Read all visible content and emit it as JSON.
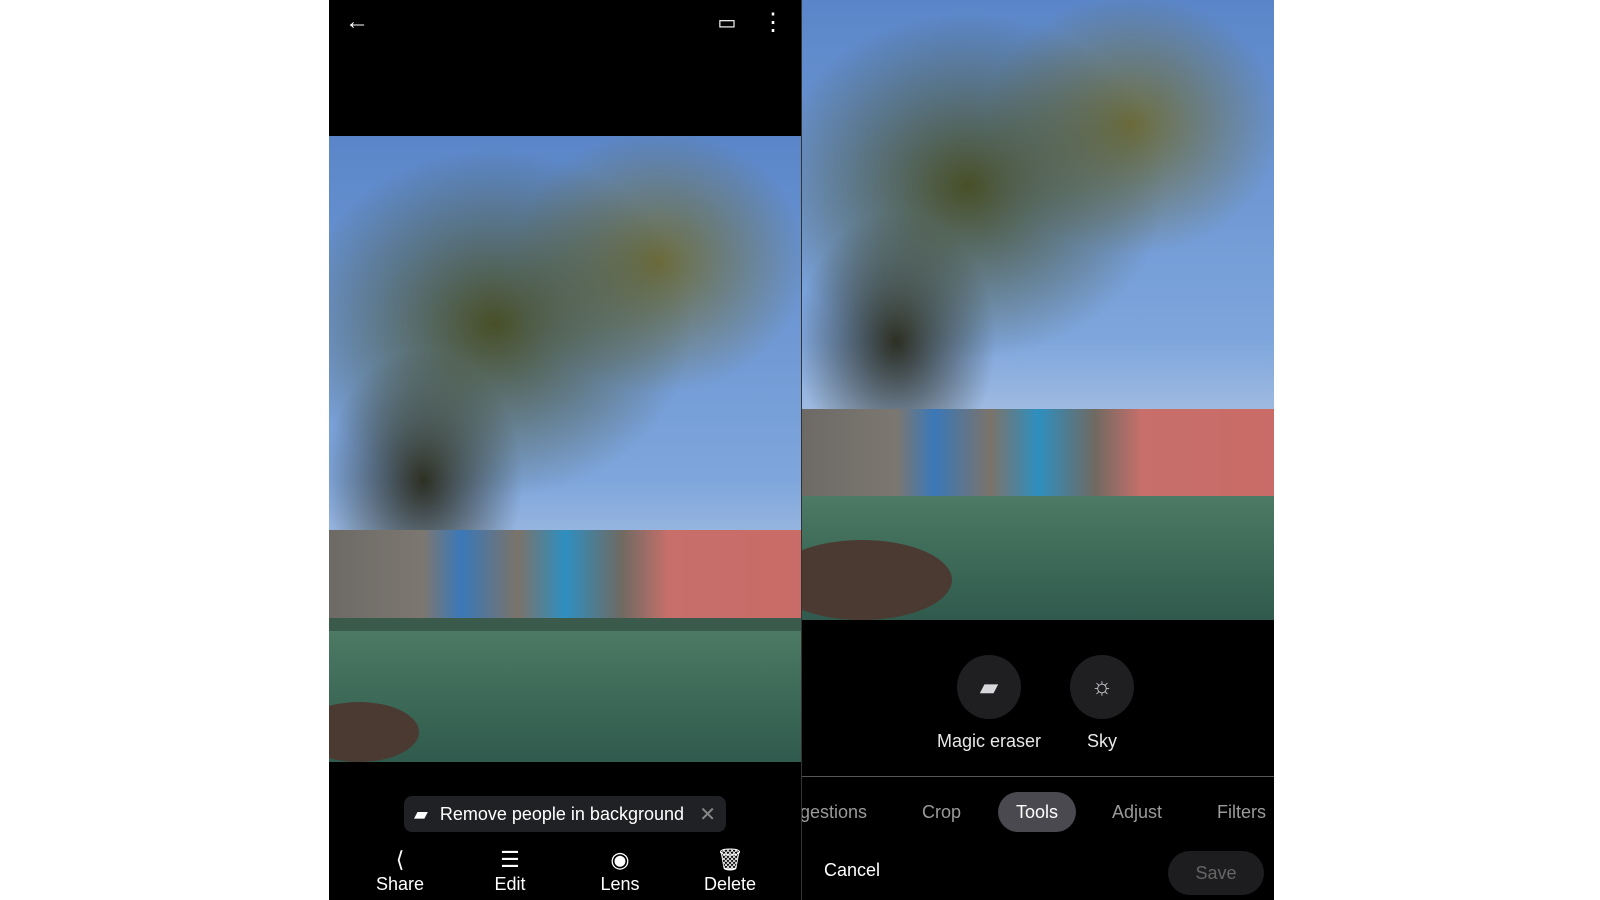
{
  "viewer": {
    "chip": {
      "icon": "eraser-icon",
      "label": "Remove people in background",
      "close_icon": "close-icon"
    },
    "actions": [
      {
        "label": "Share",
        "icon": "share-icon"
      },
      {
        "label": "Edit",
        "icon": "sliders-icon"
      },
      {
        "label": "Lens",
        "icon": "lens-icon"
      },
      {
        "label": "Delete",
        "icon": "trash-icon"
      }
    ]
  },
  "editor": {
    "tools": [
      {
        "label": "Magic eraser",
        "icon": "eraser-icon"
      },
      {
        "label": "Sky",
        "icon": "sun-cloud-icon"
      }
    ],
    "tabs": [
      {
        "label": "gestions"
      },
      {
        "label": "Crop"
      },
      {
        "label": "Tools",
        "active": true
      },
      {
        "label": "Adjust"
      },
      {
        "label": "Filters"
      }
    ],
    "cancel": "Cancel",
    "save": "Save"
  },
  "colors": {
    "background": "#000000",
    "chip": "#202124",
    "active_tab": "#4a4950"
  }
}
